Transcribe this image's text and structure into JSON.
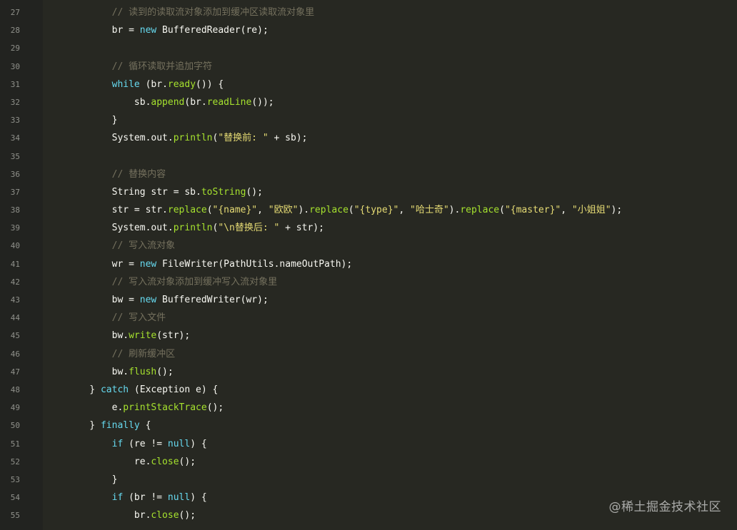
{
  "editor": {
    "theme": {
      "background": "#272822",
      "keyword": "#66d9ef",
      "function": "#a6e22e",
      "string": "#e6db74",
      "comment": "#75715e",
      "text": "#f8f8f2",
      "line_number": "#8f908a"
    },
    "lines": [
      {
        "n": "27",
        "tokens": [
          {
            "t": "        // 读到的读取流对象添加到缓冲区读取流对象里",
            "c": "com"
          }
        ]
      },
      {
        "n": "28",
        "tokens": [
          {
            "t": "        br = ",
            "c": "plain"
          },
          {
            "t": "new",
            "c": "kw"
          },
          {
            "t": " BufferedReader(re);",
            "c": "plain"
          }
        ]
      },
      {
        "n": "29",
        "tokens": []
      },
      {
        "n": "30",
        "tokens": [
          {
            "t": "        // 循环读取并追加字符",
            "c": "com"
          }
        ]
      },
      {
        "n": "31",
        "tokens": [
          {
            "t": "        ",
            "c": "plain"
          },
          {
            "t": "while",
            "c": "kw"
          },
          {
            "t": " (br.",
            "c": "plain"
          },
          {
            "t": "ready",
            "c": "fn"
          },
          {
            "t": "()) {",
            "c": "plain"
          }
        ]
      },
      {
        "n": "32",
        "tokens": [
          {
            "t": "            sb.",
            "c": "plain"
          },
          {
            "t": "append",
            "c": "fn"
          },
          {
            "t": "(br.",
            "c": "plain"
          },
          {
            "t": "readLine",
            "c": "fn"
          },
          {
            "t": "());",
            "c": "plain"
          }
        ]
      },
      {
        "n": "33",
        "tokens": [
          {
            "t": "        }",
            "c": "plain"
          }
        ]
      },
      {
        "n": "34",
        "tokens": [
          {
            "t": "        System.out.",
            "c": "plain"
          },
          {
            "t": "println",
            "c": "fn"
          },
          {
            "t": "(",
            "c": "plain"
          },
          {
            "t": "\"替换前: \"",
            "c": "str"
          },
          {
            "t": " + sb);",
            "c": "plain"
          }
        ]
      },
      {
        "n": "35",
        "tokens": []
      },
      {
        "n": "36",
        "tokens": [
          {
            "t": "        // 替换内容",
            "c": "com"
          }
        ]
      },
      {
        "n": "37",
        "tokens": [
          {
            "t": "        String str = sb.",
            "c": "plain"
          },
          {
            "t": "toString",
            "c": "fn"
          },
          {
            "t": "();",
            "c": "plain"
          }
        ]
      },
      {
        "n": "38",
        "tokens": [
          {
            "t": "        str = str.",
            "c": "plain"
          },
          {
            "t": "replace",
            "c": "fn"
          },
          {
            "t": "(",
            "c": "plain"
          },
          {
            "t": "\"{name}\"",
            "c": "str"
          },
          {
            "t": ", ",
            "c": "plain"
          },
          {
            "t": "\"欧欧\"",
            "c": "str"
          },
          {
            "t": ").",
            "c": "plain"
          },
          {
            "t": "replace",
            "c": "fn"
          },
          {
            "t": "(",
            "c": "plain"
          },
          {
            "t": "\"{type}\"",
            "c": "str"
          },
          {
            "t": ", ",
            "c": "plain"
          },
          {
            "t": "\"哈士奇\"",
            "c": "str"
          },
          {
            "t": ").",
            "c": "plain"
          },
          {
            "t": "replace",
            "c": "fn"
          },
          {
            "t": "(",
            "c": "plain"
          },
          {
            "t": "\"{master}\"",
            "c": "str"
          },
          {
            "t": ", ",
            "c": "plain"
          },
          {
            "t": "\"小姐姐\"",
            "c": "str"
          },
          {
            "t": ");",
            "c": "plain"
          }
        ]
      },
      {
        "n": "39",
        "tokens": [
          {
            "t": "        System.out.",
            "c": "plain"
          },
          {
            "t": "println",
            "c": "fn"
          },
          {
            "t": "(",
            "c": "plain"
          },
          {
            "t": "\"\\n替换后: \"",
            "c": "str"
          },
          {
            "t": " + str);",
            "c": "plain"
          }
        ]
      },
      {
        "n": "40",
        "tokens": [
          {
            "t": "        // 写入流对象",
            "c": "com"
          }
        ]
      },
      {
        "n": "41",
        "tokens": [
          {
            "t": "        wr = ",
            "c": "plain"
          },
          {
            "t": "new",
            "c": "kw"
          },
          {
            "t": " FileWriter(PathUtils.nameOutPath);",
            "c": "plain"
          }
        ]
      },
      {
        "n": "42",
        "tokens": [
          {
            "t": "        // 写入流对象添加到缓冲写入流对象里",
            "c": "com"
          }
        ]
      },
      {
        "n": "43",
        "tokens": [
          {
            "t": "        bw = ",
            "c": "plain"
          },
          {
            "t": "new",
            "c": "kw"
          },
          {
            "t": " BufferedWriter(wr);",
            "c": "plain"
          }
        ]
      },
      {
        "n": "44",
        "tokens": [
          {
            "t": "        // 写入文件",
            "c": "com"
          }
        ]
      },
      {
        "n": "45",
        "tokens": [
          {
            "t": "        bw.",
            "c": "plain"
          },
          {
            "t": "write",
            "c": "fn"
          },
          {
            "t": "(str);",
            "c": "plain"
          }
        ]
      },
      {
        "n": "46",
        "tokens": [
          {
            "t": "        // 刷新缓冲区",
            "c": "com"
          }
        ]
      },
      {
        "n": "47",
        "tokens": [
          {
            "t": "        bw.",
            "c": "plain"
          },
          {
            "t": "flush",
            "c": "fn"
          },
          {
            "t": "();",
            "c": "plain"
          }
        ]
      },
      {
        "n": "48",
        "tokens": [
          {
            "t": "    } ",
            "c": "plain"
          },
          {
            "t": "catch",
            "c": "kw"
          },
          {
            "t": " (Exception e) {",
            "c": "plain"
          }
        ]
      },
      {
        "n": "49",
        "tokens": [
          {
            "t": "        e.",
            "c": "plain"
          },
          {
            "t": "printStackTrace",
            "c": "fn"
          },
          {
            "t": "();",
            "c": "plain"
          }
        ]
      },
      {
        "n": "50",
        "tokens": [
          {
            "t": "    } ",
            "c": "plain"
          },
          {
            "t": "finally",
            "c": "kw"
          },
          {
            "t": " {",
            "c": "plain"
          }
        ]
      },
      {
        "n": "51",
        "tokens": [
          {
            "t": "        ",
            "c": "plain"
          },
          {
            "t": "if",
            "c": "kw"
          },
          {
            "t": " (re != ",
            "c": "plain"
          },
          {
            "t": "null",
            "c": "kw"
          },
          {
            "t": ") {",
            "c": "plain"
          }
        ]
      },
      {
        "n": "52",
        "tokens": [
          {
            "t": "            re.",
            "c": "plain"
          },
          {
            "t": "close",
            "c": "fn"
          },
          {
            "t": "();",
            "c": "plain"
          }
        ]
      },
      {
        "n": "53",
        "tokens": [
          {
            "t": "        }",
            "c": "plain"
          }
        ]
      },
      {
        "n": "54",
        "tokens": [
          {
            "t": "        ",
            "c": "plain"
          },
          {
            "t": "if",
            "c": "kw"
          },
          {
            "t": " (br != ",
            "c": "plain"
          },
          {
            "t": "null",
            "c": "kw"
          },
          {
            "t": ") {",
            "c": "plain"
          }
        ]
      },
      {
        "n": "55",
        "tokens": [
          {
            "t": "            br.",
            "c": "plain"
          },
          {
            "t": "close",
            "c": "fn"
          },
          {
            "t": "();",
            "c": "plain"
          }
        ]
      }
    ]
  },
  "watermark": {
    "text": "@稀土掘金技术社区"
  }
}
